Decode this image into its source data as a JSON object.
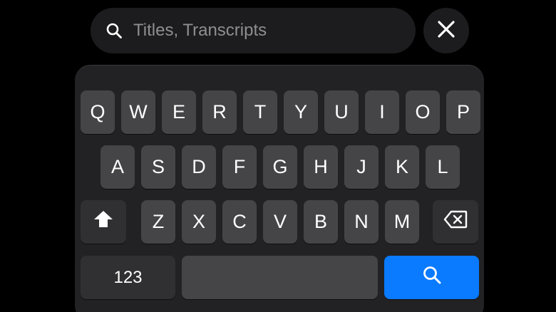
{
  "search": {
    "placeholder": "Titles, Transcripts",
    "value": ""
  },
  "keyboard": {
    "row1": [
      "Q",
      "W",
      "E",
      "R",
      "T",
      "Y",
      "U",
      "I",
      "O",
      "P"
    ],
    "row2": [
      "A",
      "S",
      "D",
      "F",
      "G",
      "H",
      "J",
      "K",
      "L"
    ],
    "row3": [
      "Z",
      "X",
      "C",
      "V",
      "B",
      "N",
      "M"
    ],
    "numbers_label": "123",
    "search_key_color": "#0a7aff"
  },
  "icons": {
    "search": "magnifier-icon",
    "close": "x-icon",
    "shift": "shift-arrow-icon",
    "delete": "backspace-icon"
  }
}
